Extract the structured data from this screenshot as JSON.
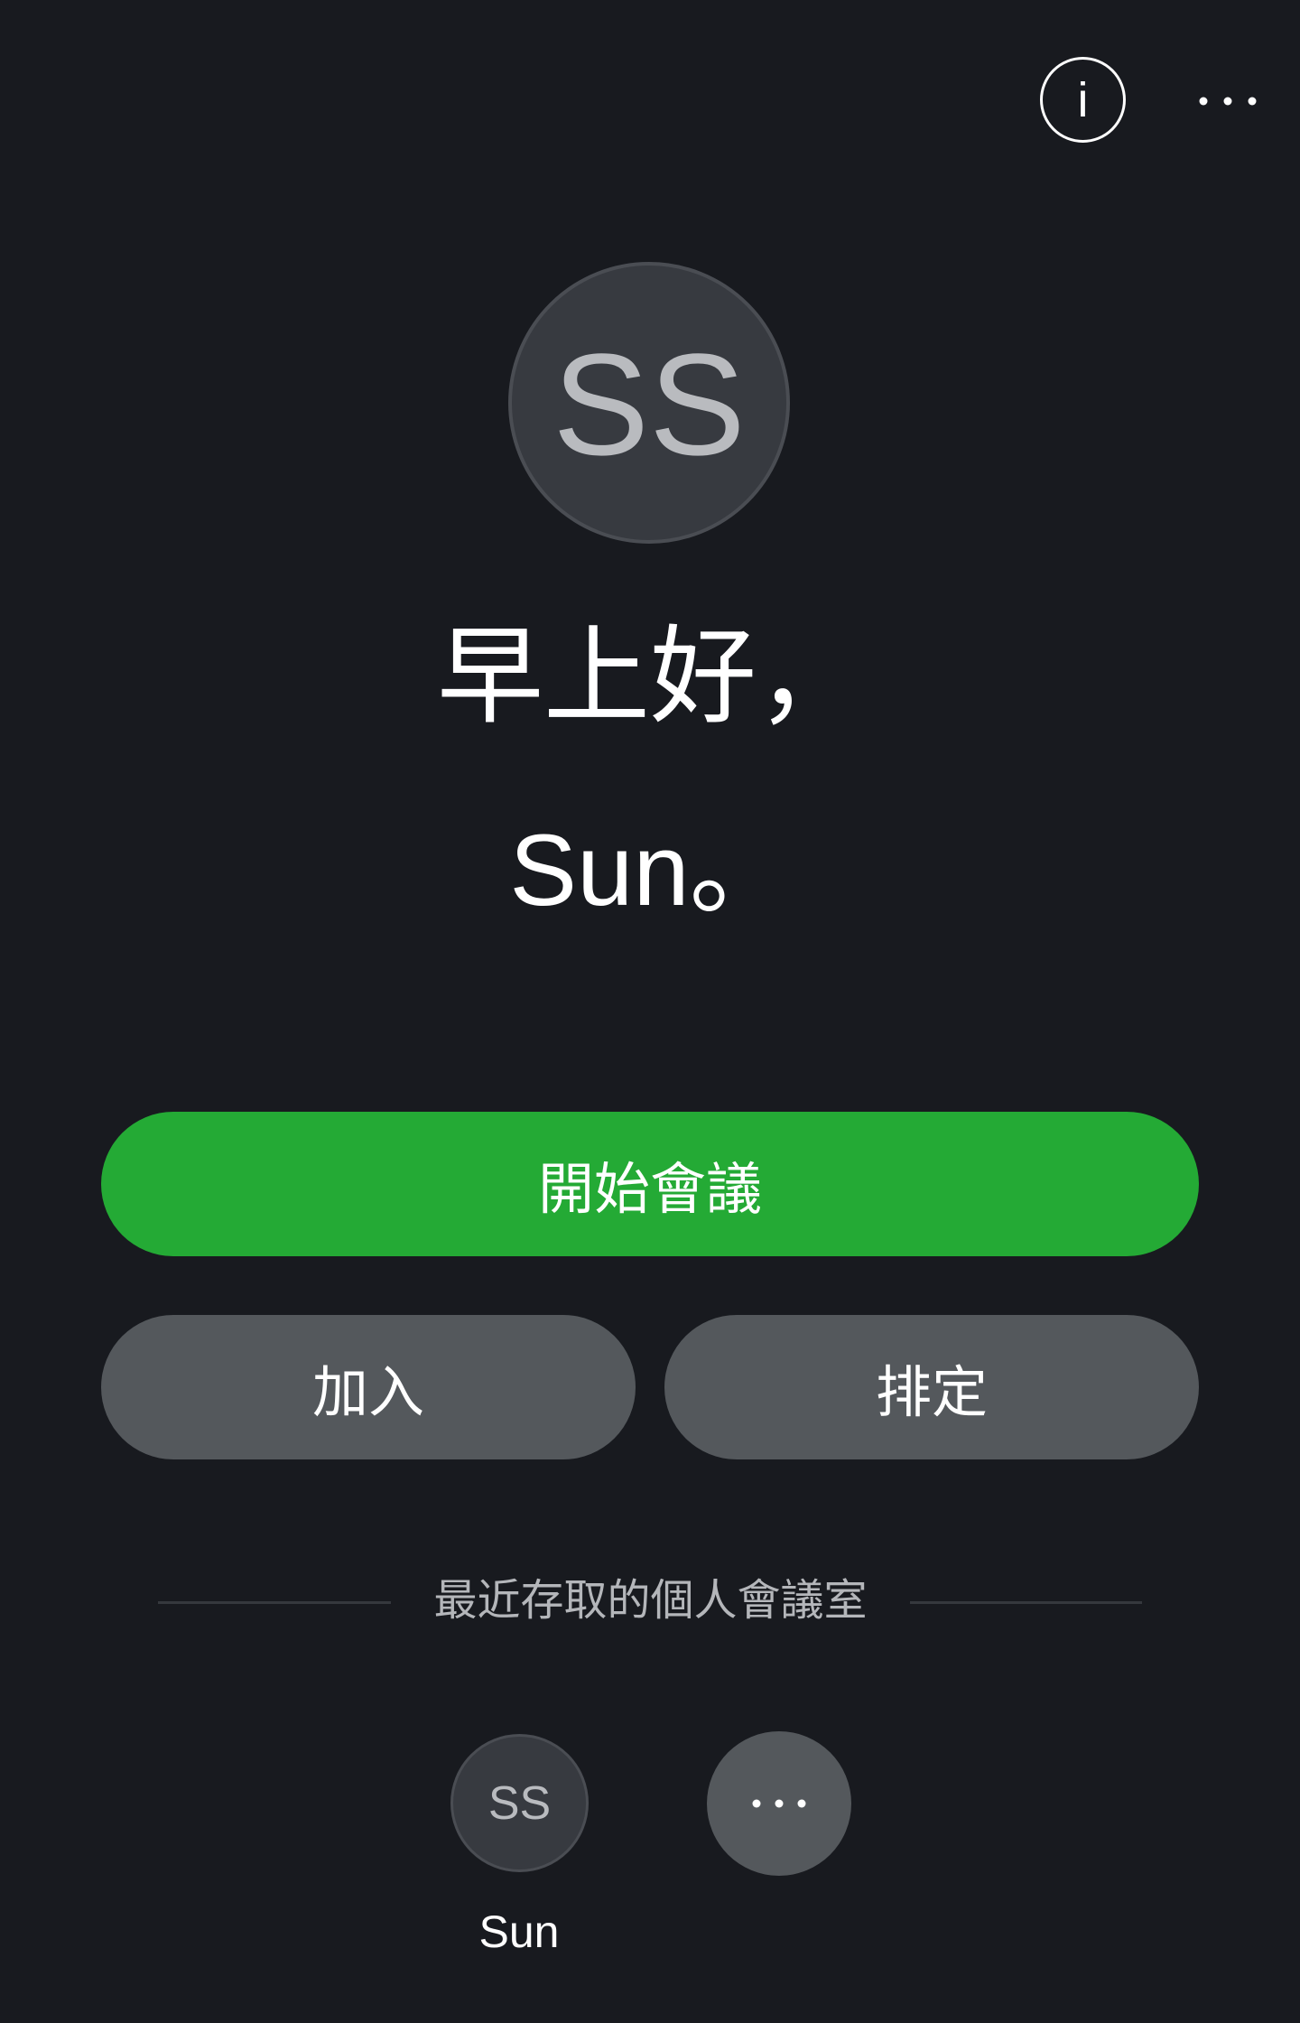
{
  "header": {
    "info_icon": "info-icon",
    "info_glyph": "i",
    "more_icon": "more-horizontal-icon"
  },
  "profile": {
    "initials": "SS"
  },
  "greeting": {
    "line1": "早上好，",
    "line2": "Sun。"
  },
  "actions": {
    "start_meeting": "開始會議",
    "join": "加入",
    "schedule": "排定",
    "start_color": "#24aa35",
    "secondary_color": "#54585c"
  },
  "recent_rooms": {
    "title": "最近存取的個人會議室",
    "items": [
      {
        "initials": "SS",
        "label": "Sun"
      }
    ],
    "more_icon": "more-horizontal-icon"
  },
  "colors": {
    "background": "#181a1f",
    "avatar_bg": "#373a40"
  }
}
